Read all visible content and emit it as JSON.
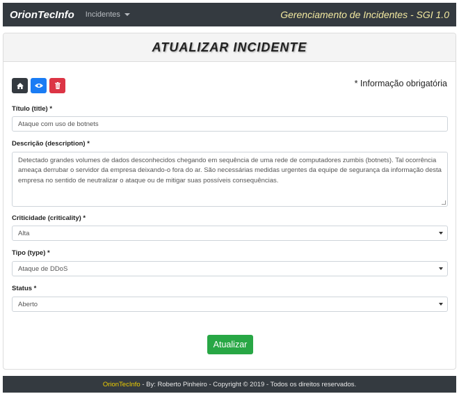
{
  "navbar": {
    "brand": "OrionTecInfo",
    "menu_label": "Incidentes",
    "right_title": "Gerenciamento de Incidentes - SGI 1.0"
  },
  "card": {
    "title": "ATUALIZAR INCIDENTE",
    "required_note": "* Informação obrigatória",
    "icons": [
      "home-icon",
      "eye-icon",
      "trash-icon"
    ],
    "fields": {
      "title": {
        "label": "Título (title) *",
        "value": "Ataque com uso de botnets"
      },
      "description": {
        "label": "Descrição (description) *",
        "value": "Detectado grandes volumes de dados desconhecidos chegando em sequência de uma rede de computadores zumbis (botnets). Tal ocorrência ameaça derrubar o servidor da empresa deixando-o fora do ar. São necessárias medidas urgentes da equipe de segurança da informação desta empresa no sentido de neutralizar o ataque ou de mitigar suas possíveis consequências."
      },
      "criticality": {
        "label": "Criticidade (criticality) *",
        "value": "Alta"
      },
      "type": {
        "label": "Tipo (type) *",
        "value": "Ataque de DDoS"
      },
      "status": {
        "label": "Status *",
        "value": "Aberto"
      }
    },
    "submit_label": "Atualizar"
  },
  "footer": {
    "brand": "OrionTecInfo",
    "text": " - By: Roberto Pinheiro - Copyright © 2019 - Todos os direitos reservados."
  },
  "colors": {
    "navbar": "#343a40",
    "right_title": "#f3e9a0",
    "home_button": "#343a40",
    "view_button": "#1a7cf4",
    "delete_button": "#dc3545",
    "submit_button": "#28a745",
    "footer_brand": "#f0d000"
  }
}
